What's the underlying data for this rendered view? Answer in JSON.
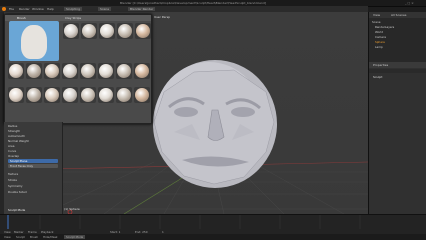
{
  "window": {
    "title": "Blender [C:\\Users\\Jonathan\\Dropbox\\Development\\Sculpt\\Head\\Blender\\HeadSculpt_blend.blend]"
  },
  "menubar": {
    "items": [
      "File",
      "Render",
      "Window",
      "Help"
    ],
    "layout_label": "Sculpting",
    "scene_label": "Scene",
    "engine_label": "Blender Render"
  },
  "brush_panel": {
    "header_label": "Brush",
    "subheader_label": "Clay Strips",
    "brushes": [
      {
        "label": "Blob"
      },
      {
        "label": "Clay"
      },
      {
        "label": "Clay Strips"
      },
      {
        "label": "Crease"
      },
      {
        "label": "Draw"
      },
      {
        "label": "Fill/Deepen"
      },
      {
        "label": "Flatten"
      },
      {
        "label": "Grab"
      },
      {
        "label": "Inflate"
      },
      {
        "label": "Layer"
      },
      {
        "label": "Mask"
      },
      {
        "label": "Nudge"
      },
      {
        "label": "Pinch"
      },
      {
        "label": "Polish"
      },
      {
        "label": "Scrape"
      },
      {
        "label": "Sculpt"
      },
      {
        "label": "Smooth"
      },
      {
        "label": "Snake Hook"
      },
      {
        "label": "Thumb"
      },
      {
        "label": "Twist"
      },
      {
        "label": "Brush"
      },
      {
        "label": "Clay"
      },
      {
        "label": "Crease"
      },
      {
        "label": "Fill"
      },
      {
        "label": "Smooth"
      },
      {
        "label": "Thumb"
      }
    ]
  },
  "left_props": {
    "rows": [
      "Radius",
      "Strength",
      "Autosmooth",
      "Normal Weight",
      "Area",
      "Curve",
      "Overlap",
      "Sculpt Plane",
      "Front Faces Only",
      "Texture",
      "Stroke",
      "Symmetry",
      "Double Sided"
    ],
    "mode_label": "Sculpt Mode"
  },
  "viewport": {
    "view_label": "User Persp",
    "object_label": "(1) Sphere"
  },
  "outliner": {
    "header_label": "View",
    "search_label": "All Scenes",
    "rows": [
      "Scene",
      "RenderLayers",
      "World",
      "Camera",
      "Sphere",
      "Lamp"
    ]
  },
  "properties": {
    "header_label": "Properties",
    "section_label": "Sculpt"
  },
  "timeline": {
    "items": [
      "View",
      "Marker",
      "Frame",
      "Playback"
    ],
    "start_label": "Start: 1",
    "end_label": "End: 250",
    "frame_label": "1"
  },
  "statusbar": {
    "items": [
      "View",
      "Sculpt",
      "Brush",
      "Hide/Mask"
    ],
    "mode_label": "Sculpt Mode"
  }
}
